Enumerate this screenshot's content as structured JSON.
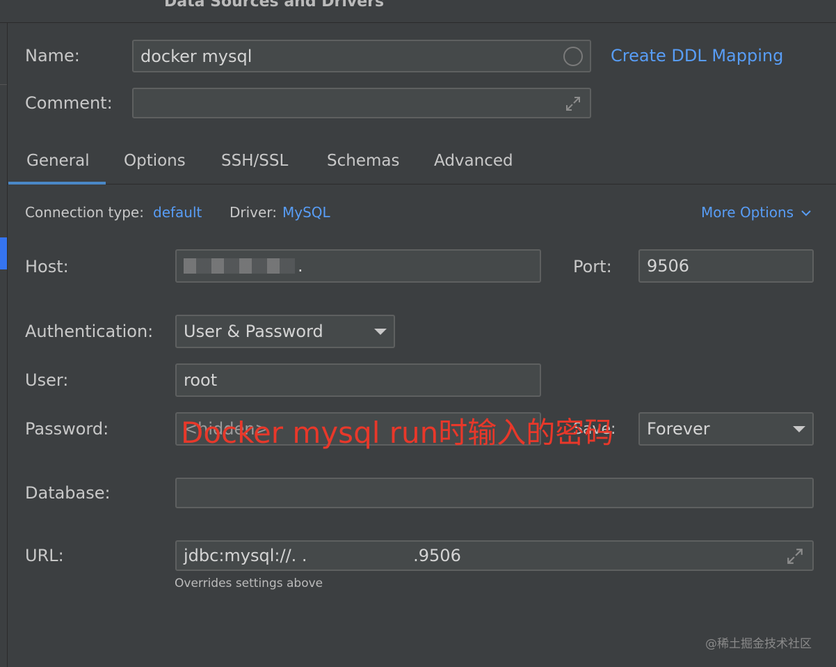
{
  "window": {
    "title": "Data Sources and Drivers"
  },
  "header": {
    "name_label": "Name:",
    "name_value": "docker mysql",
    "create_ddl_link": "Create DDL Mapping",
    "comment_label": "Comment:",
    "comment_value": ""
  },
  "tabs": [
    {
      "label": "General",
      "active": true
    },
    {
      "label": "Options",
      "active": false
    },
    {
      "label": "SSH/SSL",
      "active": false
    },
    {
      "label": "Schemas",
      "active": false
    },
    {
      "label": "Advanced",
      "active": false
    }
  ],
  "general": {
    "connection_type_label": "Connection type:",
    "connection_type_value": "default",
    "driver_label": "Driver:",
    "driver_value": "MySQL",
    "more_options": "More Options",
    "host_label": "Host:",
    "host_value": ".",
    "port_label": "Port:",
    "port_value": "9506",
    "auth_label": "Authentication:",
    "auth_value": "User & Password",
    "user_label": "User:",
    "user_value": "root",
    "password_label": "Password:",
    "password_value": "<hidden>",
    "save_label": "Save:",
    "save_value": "Forever",
    "database_label": "Database:",
    "database_value": "",
    "url_label": "URL:",
    "url_value": "jdbc:mysql://. .                    .9506",
    "url_hint": "Overrides settings above"
  },
  "annotation": "Docker mysql run时输入的密码",
  "watermark": "@稀土掘金技术社区",
  "colors": {
    "link": "#589df6",
    "annotation": "#e8382a",
    "tab_accent": "#4a88c7",
    "background": "#3c3f41"
  },
  "icons": [
    "circle-status-icon",
    "expand-icon",
    "chevron-down-icon",
    "dropdown-caret-icon"
  ]
}
